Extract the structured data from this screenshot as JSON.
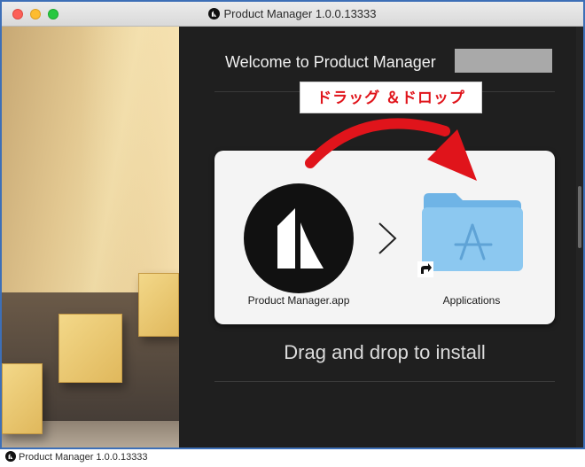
{
  "window": {
    "title": "Product Manager 1.0.0.13333",
    "app_icon": "product-manager-logo-icon"
  },
  "installer": {
    "welcome": "Welcome to Product Manager",
    "callout": "ドラッグ ＆ドロップ",
    "app_label": "Product Manager.app",
    "folder_label": "Applications",
    "instruction": "Drag and drop to install",
    "callout_color": "#e0141b",
    "panel_color": "#1f1f1f",
    "folder_color": "#8cc8f0"
  },
  "footer": {
    "caption": "Product Manager 1.0.0.13333"
  }
}
